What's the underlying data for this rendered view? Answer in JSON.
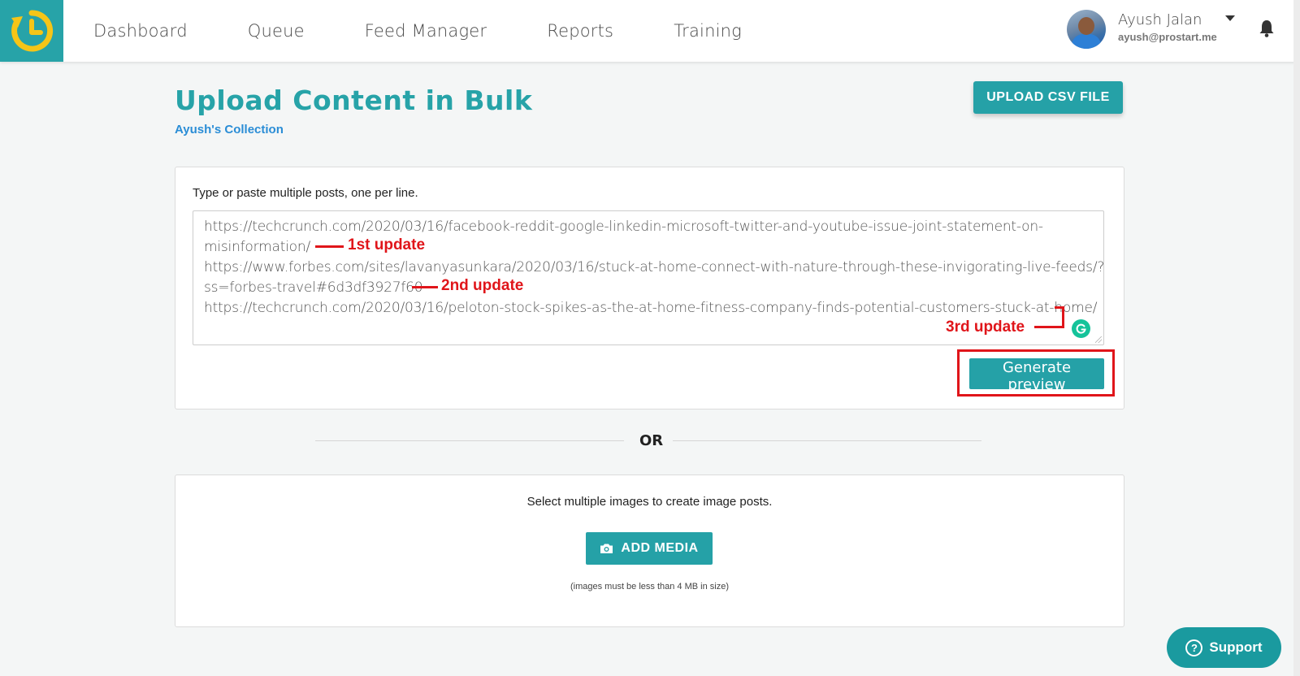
{
  "nav": {
    "items": [
      {
        "label": "Dashboard"
      },
      {
        "label": "Queue"
      },
      {
        "label": "Feed Manager"
      },
      {
        "label": "Reports"
      },
      {
        "label": "Training"
      }
    ]
  },
  "user": {
    "name": "Ayush Jalan",
    "email": "ayush@prostart.me"
  },
  "page": {
    "title": "Upload Content in Bulk",
    "collection": "Ayush's Collection",
    "upload_csv_label": "UPLOAD CSV FILE"
  },
  "text_posts": {
    "instruction": "Type or paste multiple posts, one per line.",
    "lines": [
      "https://techcrunch.com/2020/03/16/facebook-reddit-google-linkedin-microsoft-twitter-and-youtube-issue-joint-statement-on-",
      "misinformation/",
      "https://www.forbes.com/sites/lavanyasunkara/2020/03/16/stuck-at-home-connect-with-nature-through-these-invigorating-live-feeds/?",
      "ss=forbes-travel#6d3df3927f60",
      "https://techcrunch.com/2020/03/16/peloton-stock-spikes-as-the-at-home-fitness-company-finds-potential-customers-stuck-at-home/"
    ],
    "generate_preview_label": "Generate preview"
  },
  "annotations": {
    "first": "1st update",
    "second": "2nd update",
    "third": "3rd update",
    "color": "#e0151a"
  },
  "divider": {
    "label": "OR"
  },
  "media": {
    "instruction": "Select multiple images to create image posts.",
    "add_media_label": "ADD MEDIA",
    "note": "(images must be less than 4 MB in size)"
  },
  "support": {
    "label": "Support"
  },
  "colors": {
    "accent": "#27a3a8",
    "link": "#2a8dd6",
    "logo_yellow": "#f5c518"
  }
}
